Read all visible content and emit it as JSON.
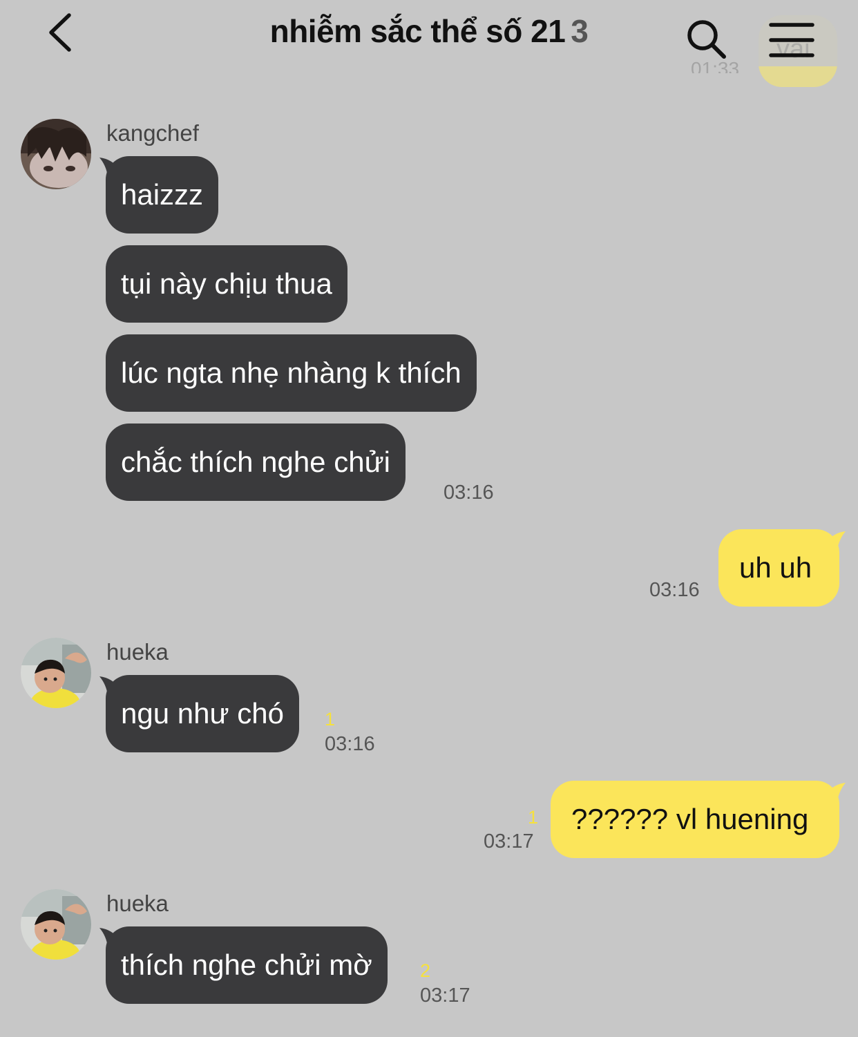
{
  "header": {
    "title": "nhiễm sắc thể số 21",
    "member_count": "3",
    "back_icon": "chevron-left-icon",
    "search_icon": "search-icon",
    "menu_icon": "hamburger-menu-icon"
  },
  "previous": {
    "text": "vai",
    "time": "01:33"
  },
  "colors": {
    "background": "#c7c7c7",
    "incoming_bubble": "#3a3a3c",
    "outgoing_bubble": "#fbe55a",
    "unread_count": "#f6e13c"
  },
  "messages": {
    "group1": {
      "sender": "kangchef",
      "m1": "haizzz",
      "m2": "tụi này chịu thua",
      "m3": "lúc ngta nhẹ nhàng k thích",
      "m4": "chắc thích nghe chửi",
      "time": "03:16"
    },
    "out1": {
      "text": "uh uh",
      "time": "03:16"
    },
    "group2": {
      "sender": "hueka",
      "m1": "ngu như chó",
      "unread": "1",
      "time": "03:16"
    },
    "out2": {
      "text": "?????? vl huening",
      "unread": "1",
      "time": "03:17"
    },
    "group3": {
      "sender": "hueka",
      "m1": "thích nghe chửi mờ",
      "unread": "2",
      "time": "03:17"
    }
  }
}
